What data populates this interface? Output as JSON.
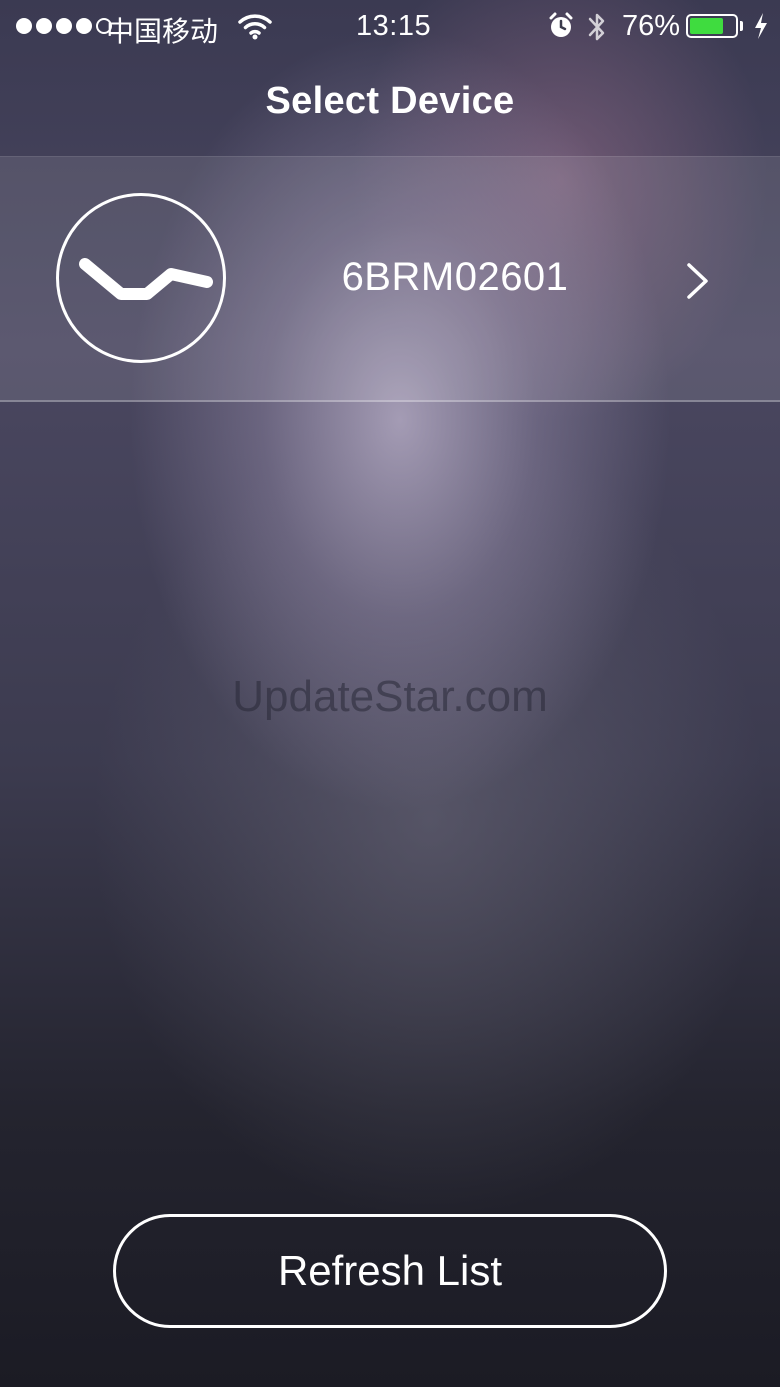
{
  "status_bar": {
    "signal_bars_filled": 4,
    "signal_bars_total": 5,
    "carrier": "中国移动",
    "time": "13:15",
    "battery_percent_label": "76%",
    "battery_level": 0.76,
    "battery_color": "#3fdc3f",
    "icons": [
      "wifi-icon",
      "alarm-icon",
      "bluetooth-icon",
      "charging-bolt-icon"
    ]
  },
  "nav": {
    "title": "Select Device"
  },
  "devices": [
    {
      "name": "6BRM02601",
      "icon": "adjustable-bed-icon",
      "accessory": "chevron-right-icon"
    }
  ],
  "watermark": "UpdateStar.com",
  "footer": {
    "refresh_label": "Refresh List"
  }
}
